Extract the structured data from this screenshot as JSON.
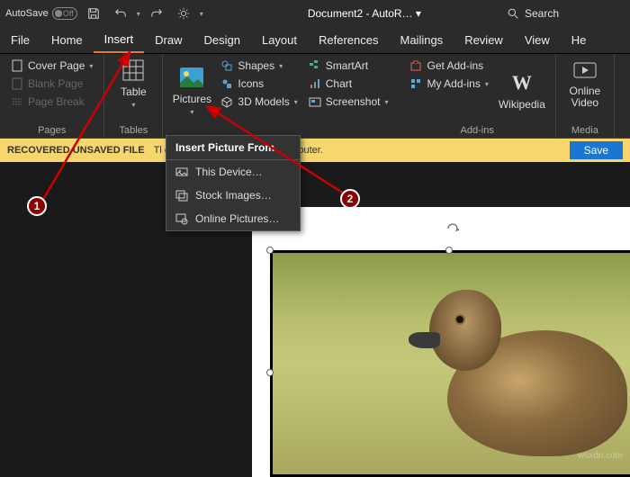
{
  "titlebar": {
    "autosave": "AutoSave",
    "autosave_state": "Off",
    "doc_title": "Document2 - AutoR… ▾",
    "search_placeholder": "Search"
  },
  "menu": [
    "File",
    "Home",
    "Insert",
    "Draw",
    "Design",
    "Layout",
    "References",
    "Mailings",
    "Review",
    "View",
    "He"
  ],
  "menu_active": "Insert",
  "ribbon": {
    "pages": {
      "label": "Pages",
      "cover": "Cover Page",
      "blank": "Blank Page",
      "break": "Page Break"
    },
    "tables": {
      "label": "Tables",
      "btn": "Table"
    },
    "illus": {
      "pictures": "Pictures",
      "shapes": "Shapes",
      "icons": "Icons",
      "models": "3D Models",
      "smartart": "SmartArt",
      "chart": "Chart",
      "screenshot": "Screenshot"
    },
    "addins": {
      "label": "Add-ins",
      "get": "Get Add-ins",
      "my": "My Add-ins",
      "wiki": "Wikipedia"
    },
    "media": {
      "label": "Media",
      "video": "Online\nVideo"
    }
  },
  "infobar": {
    "label": "RECOVERED UNSAVED FILE",
    "msg": "Tl                                          emporarily stored on your computer.",
    "save": "Save"
  },
  "dropdown": {
    "header": "Insert Picture From",
    "items": [
      "This Device…",
      "Stock Images…",
      "Online Pictures…"
    ]
  },
  "markers": {
    "m1": "1",
    "m2": "2"
  },
  "watermark": "wsxdn.com"
}
